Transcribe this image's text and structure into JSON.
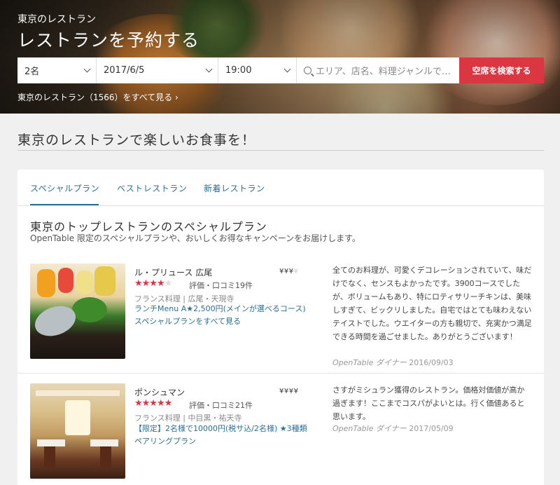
{
  "hero": {
    "subtitle": "東京のレストラン",
    "title": "レストランを予約する",
    "all_link": "東京のレストラン（1566）をすべて見る ›"
  },
  "search": {
    "party_size": "2名",
    "date": "2017/6/5",
    "time": "19:00",
    "placeholder": "エリア、店名、料理ジャンルで…",
    "button": "空席を検索する"
  },
  "main": {
    "headline": "東京のレストランで楽しいお食事を！"
  },
  "tabs": [
    {
      "label": "スペシャルプラン"
    },
    {
      "label": "ベストレストラン"
    },
    {
      "label": "新着レストラン"
    }
  ],
  "section": {
    "title": "東京のトップレストランのスペシャルプラン",
    "subtitle": "OpenTable 限定のスペシャルプランや、おいしくお得なキャンペーンをお届けします。"
  },
  "restaurants": [
    {
      "name": "ル・プリュース 広尾",
      "price_on": "¥¥¥",
      "price_off": "¥",
      "rating": 3.5,
      "stars_on": "★★★★",
      "stars_off": "★",
      "reviews": "評価・口コミ19件",
      "meta": "フランス料理 | 広尾・天現寺",
      "promo1": "ランチMenu A★2,500円(メインが選べるコース)",
      "promo2": "スペシャルプランをすべて見る",
      "review": "全てのお料理が、可愛くデコレーションされていて、味だけでなく、センスもよかったです。3900コースでしたが、ボリュームもあり、特にロティサリーチキンは、美味しすぎて、ビックリしました。自宅ではとても味わえないテイストでした。ウエイターの方も親切で、充実かつ満足できる時間を過ごせました。ありがとうございます！",
      "reviewer": "OpenTable ダイナー",
      "review_date": "2016/09/03"
    },
    {
      "name": "ポンシュマン",
      "price_on": "¥¥¥¥",
      "price_off": "",
      "rating": 5,
      "stars_on": "★★★★★",
      "stars_off": "",
      "reviews": "評価・口コミ21件",
      "meta": "フランス料理 | 中目黒・祐天寺",
      "promo1": "【限定】2名様で10000円(税サ込/2名様) ★3種類ペアリングプラン",
      "review": "さすがミシュラン獲得のレストラン。価格対価値が高か過ぎます！ここまでコスパがよいとは。行く価値あると思います。",
      "reviewer": "OpenTable ダイナー",
      "review_date": "2017/05/09"
    }
  ],
  "colors": {
    "accent": "#da3743",
    "link": "#2b6f97"
  }
}
